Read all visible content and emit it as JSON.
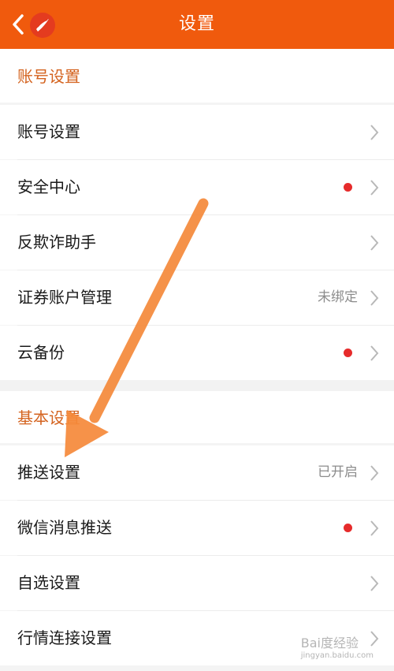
{
  "header": {
    "title": "设置",
    "back_icon": "chevron-left-icon",
    "logo_icon": "app-logo-icon",
    "bg_color": "#f05a0d"
  },
  "sections": [
    {
      "title": "账号设置",
      "rows": [
        {
          "label": "账号设置",
          "value": "",
          "dot": false
        },
        {
          "label": "安全中心",
          "value": "",
          "dot": true
        },
        {
          "label": "反欺诈助手",
          "value": "",
          "dot": false
        },
        {
          "label": "证券账户管理",
          "value": "未绑定",
          "dot": false
        },
        {
          "label": "云备份",
          "value": "",
          "dot": true
        }
      ]
    },
    {
      "title": "基本设置",
      "rows": [
        {
          "label": "推送设置",
          "value": "已开启",
          "dot": false
        },
        {
          "label": "微信消息推送",
          "value": "",
          "dot": true
        },
        {
          "label": "自选设置",
          "value": "",
          "dot": false
        },
        {
          "label": "行情连接设置",
          "value": "",
          "dot": false
        }
      ]
    }
  ],
  "watermark": {
    "text": "Bai度经验",
    "url": "jingyan.baidu.com"
  },
  "colors": {
    "accent": "#f05a0d",
    "section_title": "#d4631f",
    "badge_dot": "#e62b2b",
    "annotation_arrow": "#f5893a"
  }
}
